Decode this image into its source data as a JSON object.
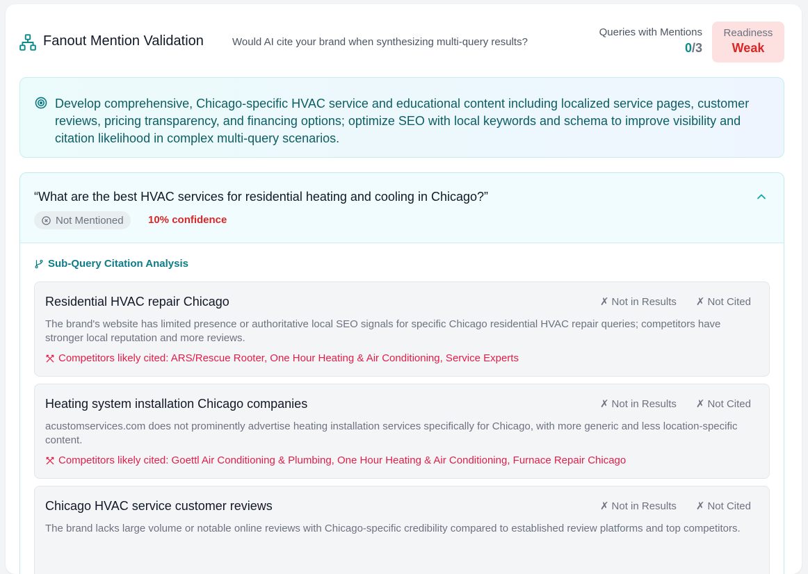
{
  "header": {
    "title": "Fanout Mention Validation",
    "subtitle": "Would AI cite your brand when synthesizing multi-query results?",
    "mentions_label": "Queries with Mentions",
    "mentions_count": "0",
    "mentions_total": "/3",
    "readiness_label": "Readiness",
    "readiness_value": "Weak",
    "icon": "sitemap-icon"
  },
  "recommendation": {
    "icon": "target-icon",
    "text": "Develop comprehensive, Chicago-specific HVAC service and educational content including localized service pages, customer reviews, pricing transparency, and financing options; optimize SEO with local keywords and schema to improve visibility and citation likelihood in complex multi-query scenarios."
  },
  "query": {
    "text": "“What are the best HVAC services for residential heating and cooling in Chicago?”",
    "status": "Not Mentioned",
    "confidence": "10% confidence",
    "subquery_heading": "Sub-Query Citation Analysis",
    "subqueries": [
      {
        "name": "Residential HVAC repair Chicago",
        "results": "Not in Results",
        "cited": "Not Cited",
        "description": "The brand's website has limited presence or authoritative local SEO signals for specific Chicago residential HVAC repair queries; competitors have stronger local reputation and more reviews.",
        "competitors": "Competitors likely cited: ARS/Rescue Rooter, One Hour Heating & Air Conditioning, Service Experts"
      },
      {
        "name": "Heating system installation Chicago companies",
        "results": "Not in Results",
        "cited": "Not Cited",
        "description": "acustomservices.com does not prominently advertise heating installation services specifically for Chicago, with more generic and less location-specific content.",
        "competitors": "Competitors likely cited: Goettl Air Conditioning & Plumbing, One Hour Heating & Air Conditioning, Furnace Repair Chicago"
      },
      {
        "name": "Chicago HVAC service customer reviews",
        "results": "Not in Results",
        "cited": "Not Cited",
        "description": "The brand lacks large volume or notable online reviews with Chicago-specific credibility compared to established review platforms and top competitors.",
        "competitors": ""
      }
    ]
  },
  "colors": {
    "accent": "#0e8a8a",
    "danger": "#dc2626",
    "competitor": "#e11d48"
  }
}
